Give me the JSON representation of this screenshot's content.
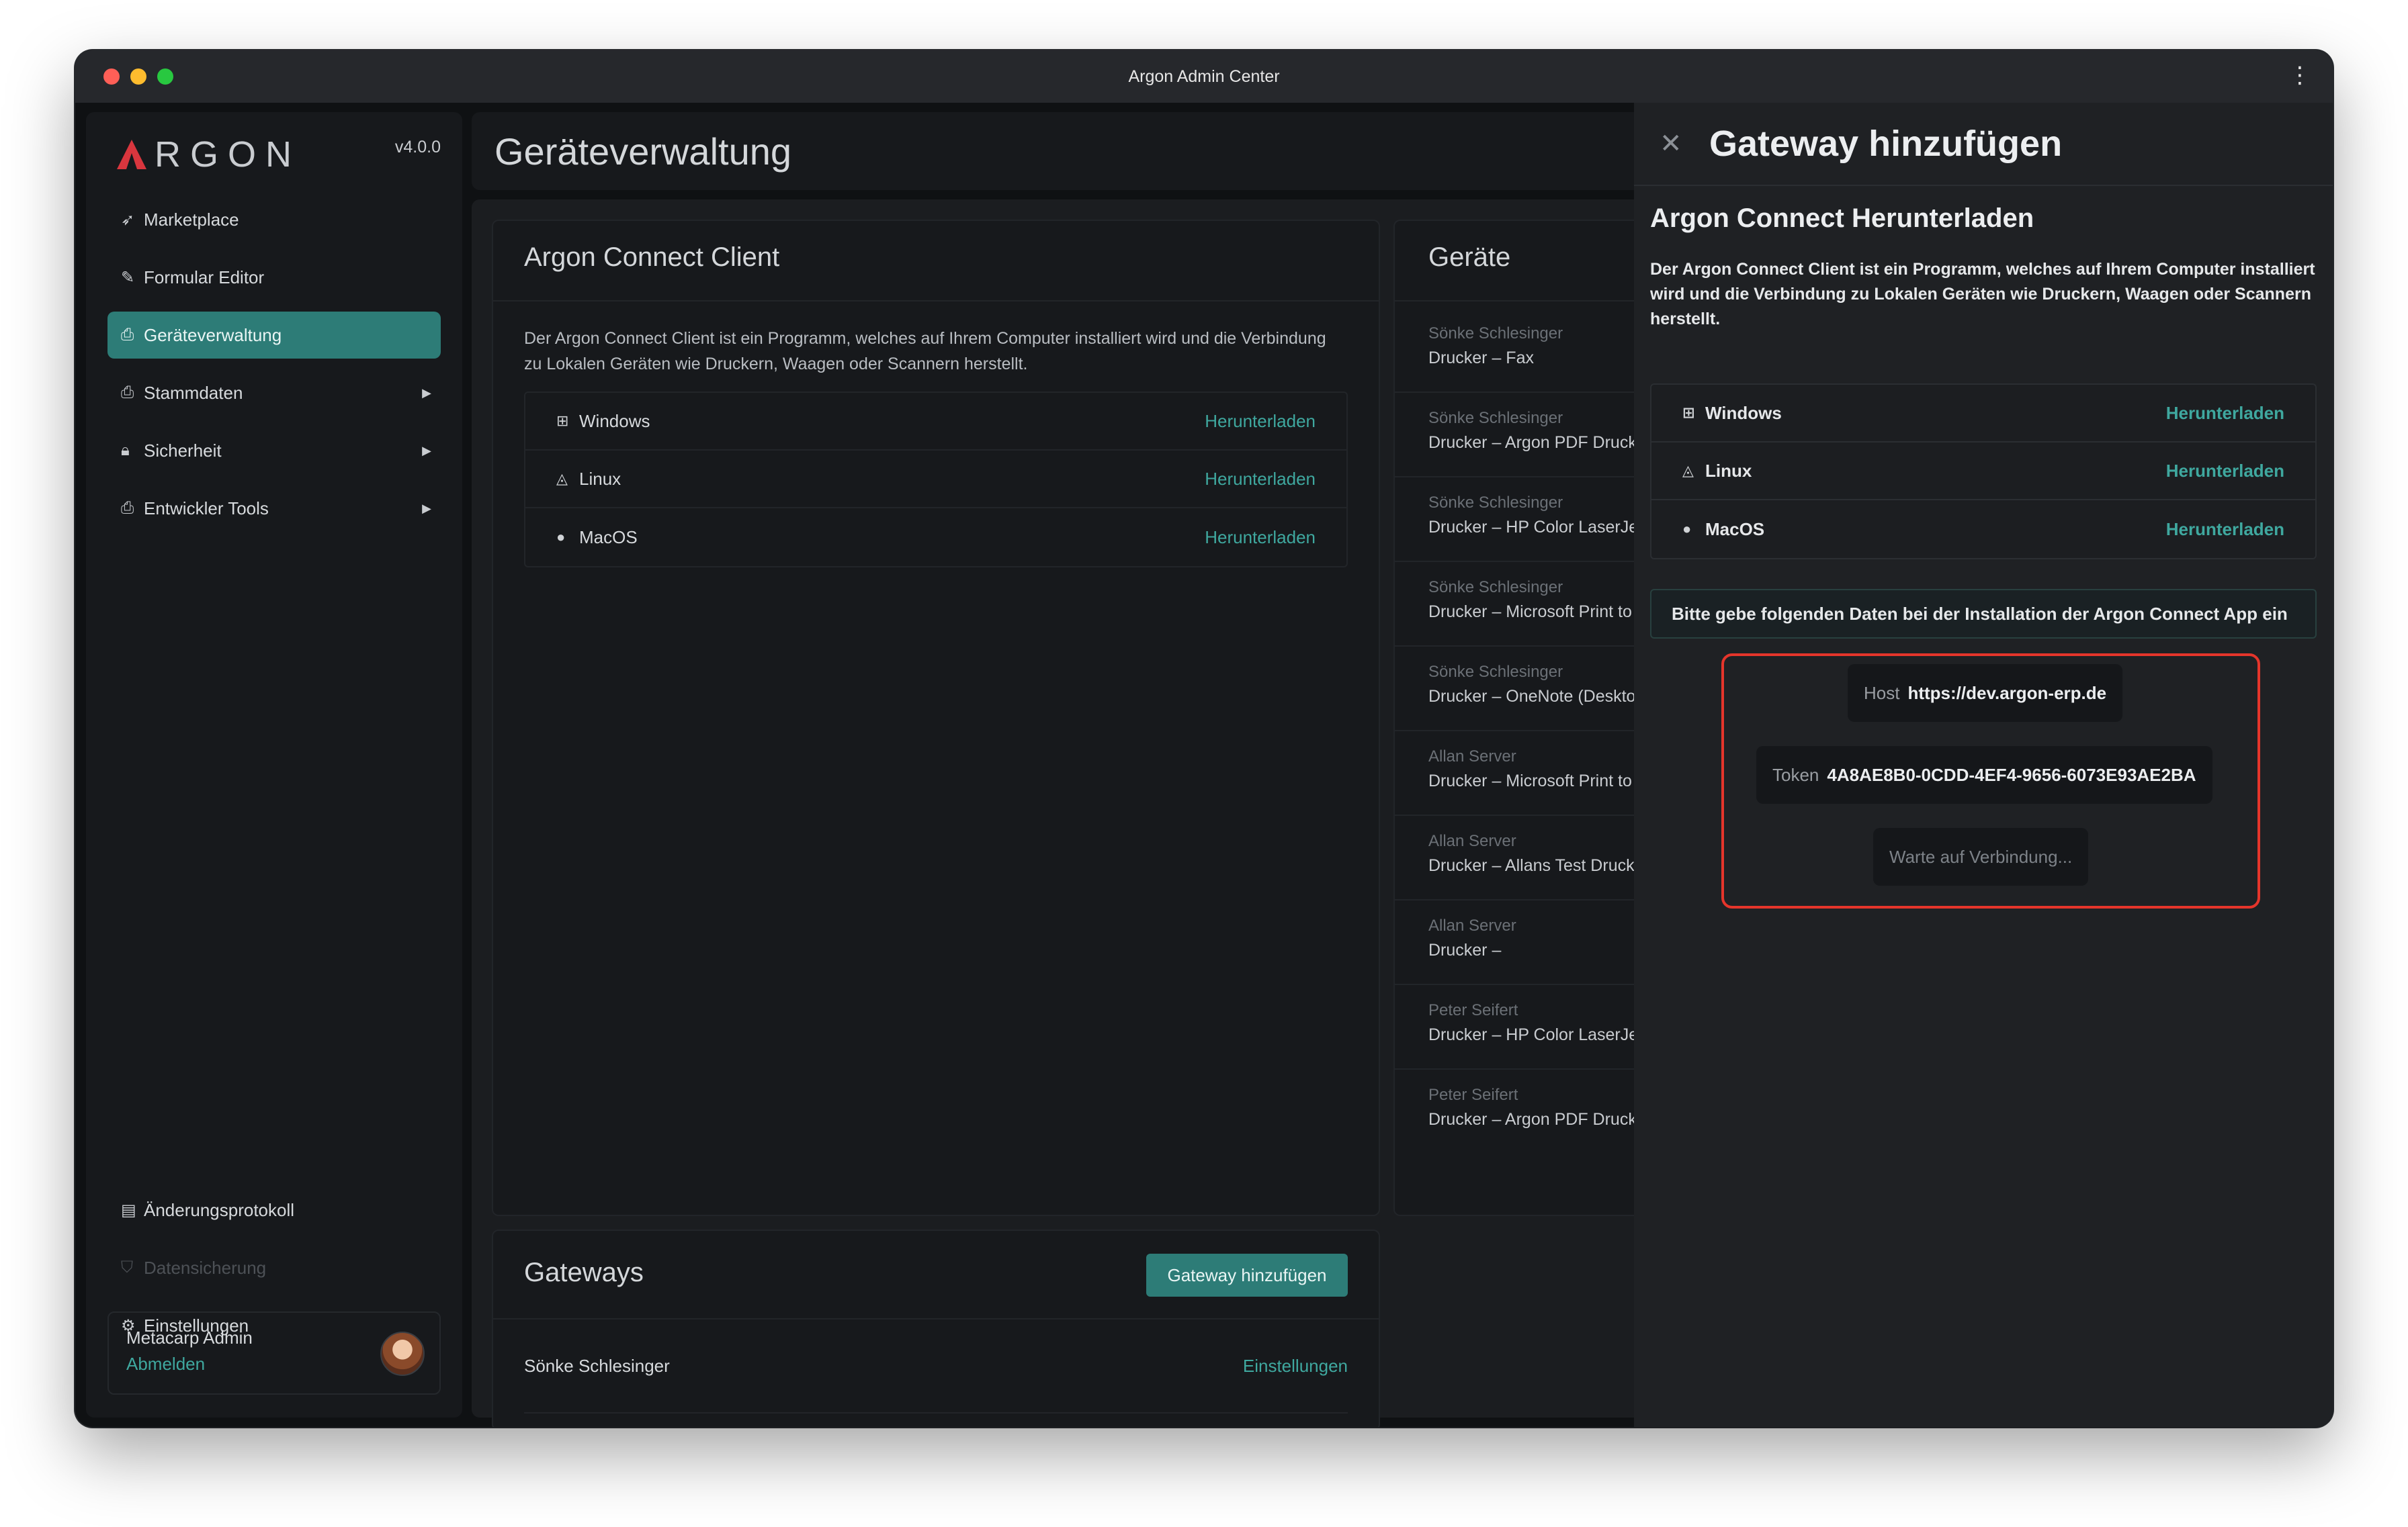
{
  "window": {
    "title": "Argon Admin Center"
  },
  "sidebar": {
    "logo_text": "RGON",
    "version": "v4.0.0",
    "items": [
      {
        "label": "Marketplace",
        "icon": "rocket-icon"
      },
      {
        "label": "Formular Editor",
        "icon": "pen-icon"
      },
      {
        "label": "Geräteverwaltung",
        "icon": "printer-icon",
        "active": true
      },
      {
        "label": "Stammdaten",
        "icon": "printer-icon",
        "has_submenu": true
      },
      {
        "label": "Sicherheit",
        "icon": "lock-icon",
        "has_submenu": true
      },
      {
        "label": "Entwickler Tools",
        "icon": "printer-icon",
        "has_submenu": true
      }
    ],
    "bottom_items": [
      {
        "label": "Änderungsprotokoll",
        "icon": "file-icon"
      },
      {
        "label": "Datensicherung",
        "icon": "shield-icon",
        "disabled": true
      },
      {
        "label": "Einstellungen",
        "icon": "gears-icon"
      }
    ],
    "user": {
      "name": "Metacarp Admin",
      "logout_label": "Abmelden"
    }
  },
  "main": {
    "title": "Geräteverwaltung",
    "client_card": {
      "title": "Argon Connect Client",
      "description": "Der Argon Connect Client ist ein Programm, welches auf Ihrem Computer installiert wird und die Verbindung zu Lokalen Geräten wie Druckern, Waagen oder Scannern herstellt.",
      "downloads": [
        {
          "os": "Windows",
          "link": "Herunterladen"
        },
        {
          "os": "Linux",
          "link": "Herunterladen"
        },
        {
          "os": "MacOS",
          "link": "Herunterladen"
        }
      ]
    },
    "devices_card": {
      "title": "Geräte",
      "devices": [
        {
          "owner": "Sönke Schlesinger",
          "name": "Drucker – Fax"
        },
        {
          "owner": "Sönke Schlesinger",
          "name": "Drucker – Argon PDF Druck"
        },
        {
          "owner": "Sönke Schlesinger",
          "name": "Drucker – HP Color LaserJet"
        },
        {
          "owner": "Sönke Schlesinger",
          "name": "Drucker – Microsoft Print to"
        },
        {
          "owner": "Sönke Schlesinger",
          "name": "Drucker – OneNote (Deskto"
        },
        {
          "owner": "Allan Server",
          "name": "Drucker – Microsoft Print to"
        },
        {
          "owner": "Allan Server",
          "name": "Drucker – Allans Test Druck"
        },
        {
          "owner": "Allan Server",
          "name": "Drucker –"
        },
        {
          "owner": "Peter Seifert",
          "name": "Drucker – HP Color LaserJet"
        },
        {
          "owner": "Peter Seifert",
          "name": "Drucker – Argon PDF Druck"
        }
      ]
    },
    "gateways_card": {
      "title": "Gateways",
      "add_button": "Gateway hinzufügen",
      "rows": [
        {
          "name": "Sönke Schlesinger",
          "link": "Einstellungen"
        }
      ]
    }
  },
  "drawer": {
    "title": "Gateway hinzufügen",
    "subtitle": "Argon Connect Herunterladen",
    "description": "Der Argon Connect Client ist ein Programm, welches auf Ihrem Computer installiert wird und die Verbindung zu Lokalen Geräten wie Druckern, Waagen oder Scannern herstellt.",
    "downloads": [
      {
        "os": "Windows",
        "link": "Herunterladen"
      },
      {
        "os": "Linux",
        "link": "Herunterladen"
      },
      {
        "os": "MacOS",
        "link": "Herunterladen"
      }
    ],
    "info": "Bitte gebe folgenden Daten bei der Installation der Argon Connect App ein",
    "host_label": "Host",
    "host_value": "https://dev.argon-erp.de",
    "token_label": "Token",
    "token_value": "4A8AE8B0-0CDD-4EF4-9656-6073E93AE2BA",
    "waiting": "Warte auf Verbindung..."
  },
  "colors": {
    "accent": "#2d7c77",
    "link": "#3fa89f",
    "highlight_border": "#e5352b",
    "brand": "#d9363e"
  }
}
